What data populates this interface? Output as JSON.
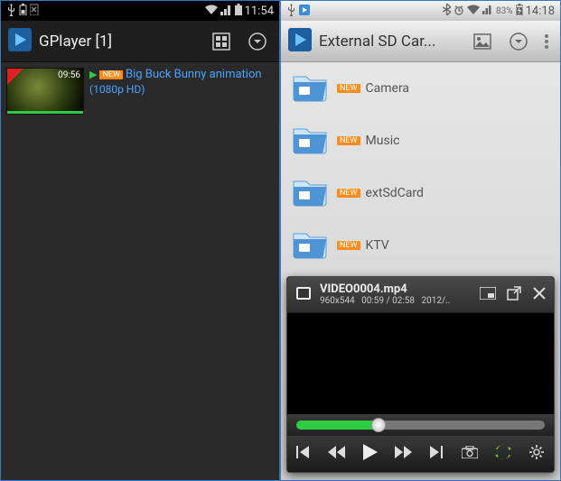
{
  "left": {
    "status": {
      "time": "11:54"
    },
    "appbar": {
      "title": "GPlayer [1]"
    },
    "video": {
      "duration": "09:56",
      "new_badge": "NEW",
      "title": "Big Buck Bunny animation",
      "subtitle": "(1080p HD)"
    }
  },
  "right": {
    "status": {
      "battery_text": "83%",
      "time": "14:18"
    },
    "appbar": {
      "title": "External SD Car..."
    },
    "folders": [
      {
        "badge": "NEW",
        "name": "Camera"
      },
      {
        "badge": "NEW",
        "name": "Music"
      },
      {
        "badge": "NEW",
        "name": "extSdCard"
      },
      {
        "badge": "NEW",
        "name": "KTV"
      }
    ],
    "player": {
      "filename": "VIDEO0004.mp4",
      "resolution": "960x544",
      "elapsed": "00:59",
      "total": "02:58",
      "date": "2012/.."
    }
  }
}
